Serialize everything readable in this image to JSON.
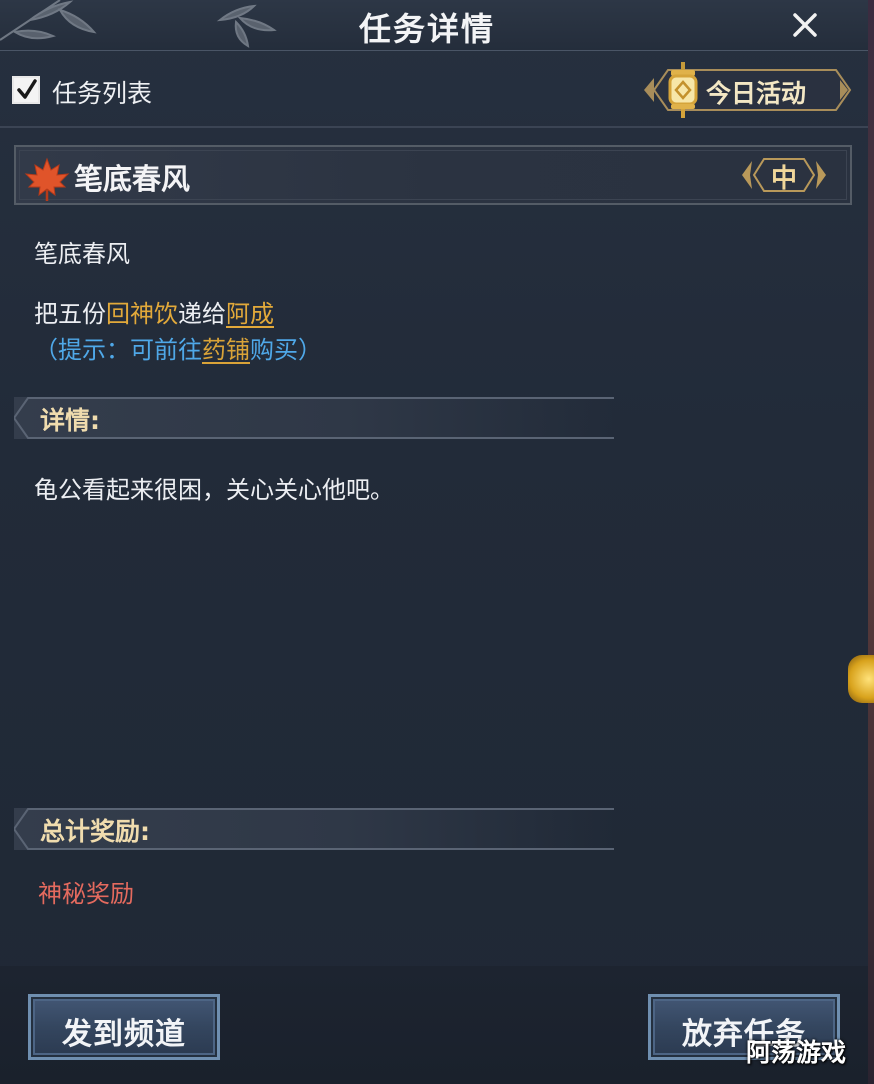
{
  "window": {
    "title": "任务详情"
  },
  "toolbar": {
    "task_list_label": "任务列表",
    "task_list_checked": true,
    "today_activity_label": "今日活动"
  },
  "task": {
    "title": "笔底春风",
    "difficulty": "中",
    "name": "笔底春风",
    "objective": {
      "prefix": "把五份",
      "item": "回神饮",
      "middle": "递给",
      "npc": "阿成"
    },
    "hint": {
      "open": "（提示：可前往",
      "place": "药铺",
      "close": "购买）"
    },
    "details_heading": "详情:",
    "details_text": "龟公看起来很困，关心关心他吧。",
    "rewards_heading": "总计奖励:",
    "reward": "神秘奖励"
  },
  "buttons": {
    "share": "发到频道",
    "abandon": "放弃任务"
  },
  "watermark": "阿荡游戏",
  "colors": {
    "highlight_gold": "#e2a93a",
    "hint_blue": "#4fa8e8",
    "reward_red": "#e46a5e",
    "section_heading": "#f0dcae"
  },
  "icons": {
    "close": "close-icon",
    "checkbox": "checkmark-icon",
    "lantern": "lantern-icon",
    "maple": "maple-leaf-icon"
  }
}
